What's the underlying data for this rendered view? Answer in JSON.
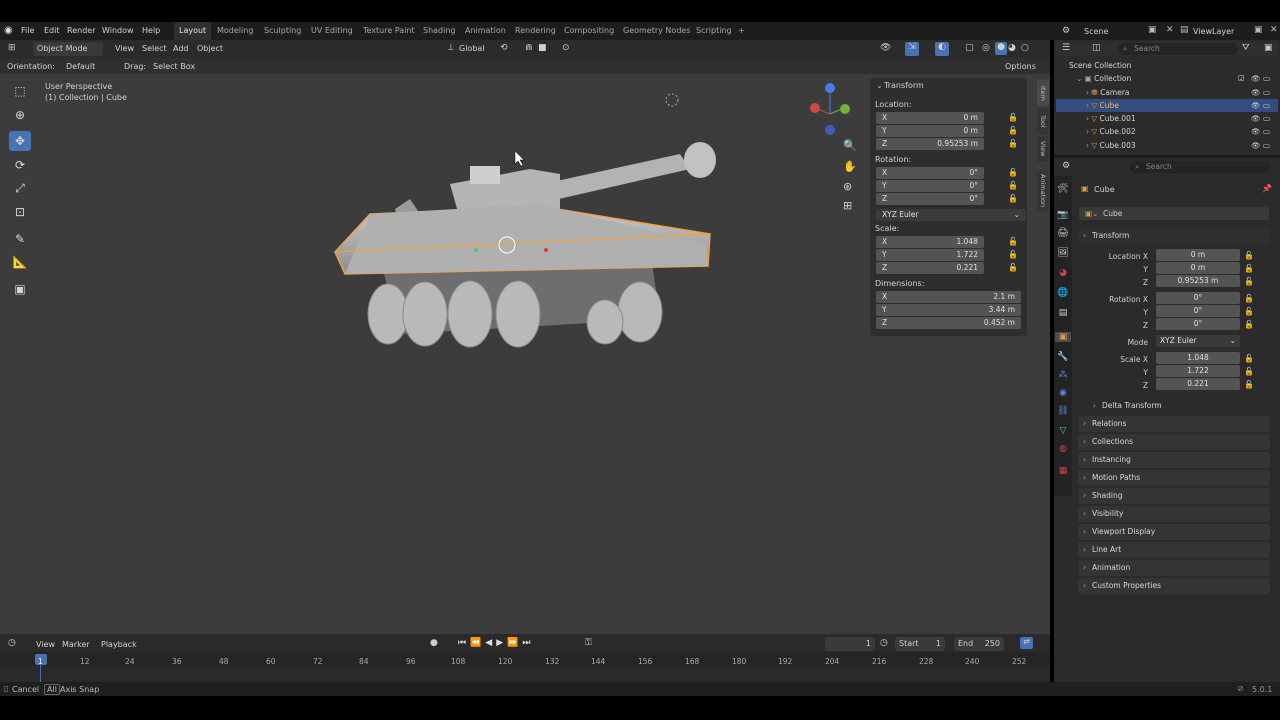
{
  "menu": [
    "File",
    "Edit",
    "Render",
    "Window",
    "Help"
  ],
  "workspaces": [
    "Layout",
    "Modeling",
    "Sculpting",
    "UV Editing",
    "Texture Paint",
    "Shading",
    "Animation",
    "Rendering",
    "Compositing",
    "Geometry Nodes",
    "Scripting"
  ],
  "workspace_add": "+",
  "scene_name": "Scene",
  "view_layer": "ViewLayer",
  "header": {
    "mode": "Object Mode",
    "view": "View",
    "select": "Select",
    "add": "Add",
    "object": "Object",
    "transform_space": "Global"
  },
  "subheader": {
    "orientation_label": "Orientation:",
    "orientation": "Default",
    "drag_label": "Drag:",
    "drag": "Select Box",
    "options": "Options"
  },
  "viewport": {
    "perspective": "User Perspective",
    "collection": "(1) Collection | Cube"
  },
  "npanel": {
    "title": "Transform",
    "location_label": "Location:",
    "location": [
      {
        "axis": "X",
        "value": "0 m"
      },
      {
        "axis": "Y",
        "value": "0 m"
      },
      {
        "axis": "Z",
        "value": "0.95253 m"
      }
    ],
    "rotation_label": "Rotation:",
    "rotation": [
      {
        "axis": "X",
        "value": "0°"
      },
      {
        "axis": "Y",
        "value": "0°"
      },
      {
        "axis": "Z",
        "value": "0°"
      }
    ],
    "rotation_mode": "XYZ Euler",
    "scale_label": "Scale:",
    "scale": [
      {
        "axis": "X",
        "value": "1.048"
      },
      {
        "axis": "Y",
        "value": "1.722"
      },
      {
        "axis": "Z",
        "value": "0.221"
      }
    ],
    "dimensions_label": "Dimensions:",
    "dimensions": [
      {
        "axis": "X",
        "value": "2.1 m"
      },
      {
        "axis": "Y",
        "value": "3.44 m"
      },
      {
        "axis": "Z",
        "value": "0.452 m"
      }
    ],
    "tabs": [
      "Item",
      "Tool",
      "View",
      "Animation"
    ]
  },
  "outliner": {
    "search_placeholder": "Search",
    "root": "Scene Collection",
    "collection": "Collection",
    "items": [
      "Camera",
      "Cube",
      "Cube.001",
      "Cube.002",
      "Cube.003"
    ]
  },
  "properties": {
    "search_placeholder": "Search",
    "object_name": "Cube",
    "data_name": "Cube",
    "transform": "Transform",
    "location_x_label": "Location X",
    "location": [
      "0 m",
      "0 m",
      "0.95253 m"
    ],
    "rotation_x_label": "Rotation X",
    "rotation": [
      "0°",
      "0°",
      "0°"
    ],
    "mode_label": "Mode",
    "mode": "XYZ Euler",
    "scale_x_label": "Scale X",
    "scale": [
      "1.048",
      "1.722",
      "0.221"
    ],
    "y_label": "Y",
    "z_label": "Z",
    "delta": "Delta Transform",
    "sections": [
      "Relations",
      "Collections",
      "Instancing",
      "Motion Paths",
      "Shading",
      "Visibility",
      "Viewport Display",
      "Line Art",
      "Animation",
      "Custom Properties"
    ]
  },
  "timeline": {
    "view": "View",
    "marker": "Marker",
    "playback": "Playback",
    "current_frame": "1",
    "start_label": "Start",
    "start": "1",
    "end_label": "End",
    "end": "250",
    "ticks": [
      "1",
      "12",
      "24",
      "36",
      "48",
      "60",
      "72",
      "84",
      "96",
      "108",
      "120",
      "132",
      "144",
      "156",
      "168",
      "180",
      "192",
      "204",
      "216",
      "228",
      "240",
      "252"
    ]
  },
  "status": {
    "cancel": "Cancel",
    "all": "All",
    "axis_snap": "Axis Snap",
    "version": "5.0.1"
  },
  "colors": {
    "selection": "#f0a040",
    "accent": "#4772b3"
  }
}
